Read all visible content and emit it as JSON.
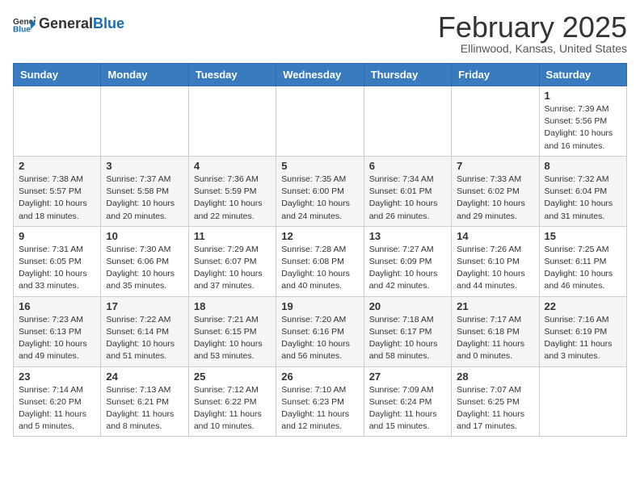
{
  "logo": {
    "general": "General",
    "blue": "Blue"
  },
  "header": {
    "month": "February 2025",
    "location": "Ellinwood, Kansas, United States"
  },
  "days_of_week": [
    "Sunday",
    "Monday",
    "Tuesday",
    "Wednesday",
    "Thursday",
    "Friday",
    "Saturday"
  ],
  "weeks": [
    [
      {
        "day": "",
        "info": ""
      },
      {
        "day": "",
        "info": ""
      },
      {
        "day": "",
        "info": ""
      },
      {
        "day": "",
        "info": ""
      },
      {
        "day": "",
        "info": ""
      },
      {
        "day": "",
        "info": ""
      },
      {
        "day": "1",
        "info": "Sunrise: 7:39 AM\nSunset: 5:56 PM\nDaylight: 10 hours and 16 minutes."
      }
    ],
    [
      {
        "day": "2",
        "info": "Sunrise: 7:38 AM\nSunset: 5:57 PM\nDaylight: 10 hours and 18 minutes."
      },
      {
        "day": "3",
        "info": "Sunrise: 7:37 AM\nSunset: 5:58 PM\nDaylight: 10 hours and 20 minutes."
      },
      {
        "day": "4",
        "info": "Sunrise: 7:36 AM\nSunset: 5:59 PM\nDaylight: 10 hours and 22 minutes."
      },
      {
        "day": "5",
        "info": "Sunrise: 7:35 AM\nSunset: 6:00 PM\nDaylight: 10 hours and 24 minutes."
      },
      {
        "day": "6",
        "info": "Sunrise: 7:34 AM\nSunset: 6:01 PM\nDaylight: 10 hours and 26 minutes."
      },
      {
        "day": "7",
        "info": "Sunrise: 7:33 AM\nSunset: 6:02 PM\nDaylight: 10 hours and 29 minutes."
      },
      {
        "day": "8",
        "info": "Sunrise: 7:32 AM\nSunset: 6:04 PM\nDaylight: 10 hours and 31 minutes."
      }
    ],
    [
      {
        "day": "9",
        "info": "Sunrise: 7:31 AM\nSunset: 6:05 PM\nDaylight: 10 hours and 33 minutes."
      },
      {
        "day": "10",
        "info": "Sunrise: 7:30 AM\nSunset: 6:06 PM\nDaylight: 10 hours and 35 minutes."
      },
      {
        "day": "11",
        "info": "Sunrise: 7:29 AM\nSunset: 6:07 PM\nDaylight: 10 hours and 37 minutes."
      },
      {
        "day": "12",
        "info": "Sunrise: 7:28 AM\nSunset: 6:08 PM\nDaylight: 10 hours and 40 minutes."
      },
      {
        "day": "13",
        "info": "Sunrise: 7:27 AM\nSunset: 6:09 PM\nDaylight: 10 hours and 42 minutes."
      },
      {
        "day": "14",
        "info": "Sunrise: 7:26 AM\nSunset: 6:10 PM\nDaylight: 10 hours and 44 minutes."
      },
      {
        "day": "15",
        "info": "Sunrise: 7:25 AM\nSunset: 6:11 PM\nDaylight: 10 hours and 46 minutes."
      }
    ],
    [
      {
        "day": "16",
        "info": "Sunrise: 7:23 AM\nSunset: 6:13 PM\nDaylight: 10 hours and 49 minutes."
      },
      {
        "day": "17",
        "info": "Sunrise: 7:22 AM\nSunset: 6:14 PM\nDaylight: 10 hours and 51 minutes."
      },
      {
        "day": "18",
        "info": "Sunrise: 7:21 AM\nSunset: 6:15 PM\nDaylight: 10 hours and 53 minutes."
      },
      {
        "day": "19",
        "info": "Sunrise: 7:20 AM\nSunset: 6:16 PM\nDaylight: 10 hours and 56 minutes."
      },
      {
        "day": "20",
        "info": "Sunrise: 7:18 AM\nSunset: 6:17 PM\nDaylight: 10 hours and 58 minutes."
      },
      {
        "day": "21",
        "info": "Sunrise: 7:17 AM\nSunset: 6:18 PM\nDaylight: 11 hours and 0 minutes."
      },
      {
        "day": "22",
        "info": "Sunrise: 7:16 AM\nSunset: 6:19 PM\nDaylight: 11 hours and 3 minutes."
      }
    ],
    [
      {
        "day": "23",
        "info": "Sunrise: 7:14 AM\nSunset: 6:20 PM\nDaylight: 11 hours and 5 minutes."
      },
      {
        "day": "24",
        "info": "Sunrise: 7:13 AM\nSunset: 6:21 PM\nDaylight: 11 hours and 8 minutes."
      },
      {
        "day": "25",
        "info": "Sunrise: 7:12 AM\nSunset: 6:22 PM\nDaylight: 11 hours and 10 minutes."
      },
      {
        "day": "26",
        "info": "Sunrise: 7:10 AM\nSunset: 6:23 PM\nDaylight: 11 hours and 12 minutes."
      },
      {
        "day": "27",
        "info": "Sunrise: 7:09 AM\nSunset: 6:24 PM\nDaylight: 11 hours and 15 minutes."
      },
      {
        "day": "28",
        "info": "Sunrise: 7:07 AM\nSunset: 6:25 PM\nDaylight: 11 hours and 17 minutes."
      },
      {
        "day": "",
        "info": ""
      }
    ]
  ]
}
